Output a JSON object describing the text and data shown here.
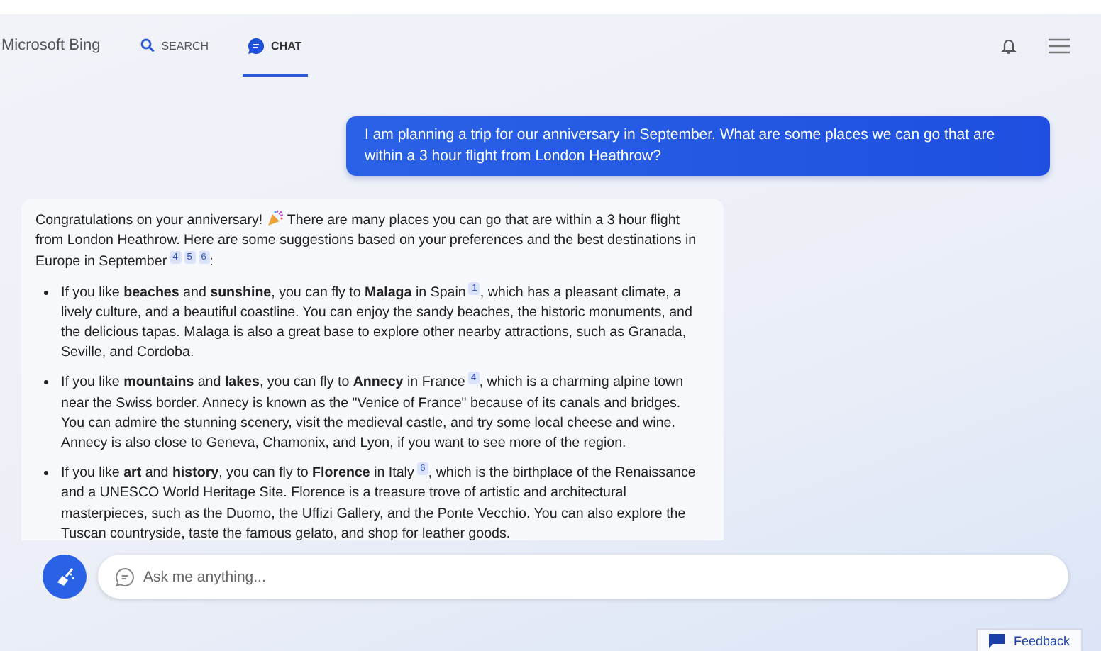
{
  "header": {
    "logo": "Microsoft Bing",
    "tabs": [
      {
        "label": "SEARCH",
        "kind": "search",
        "selected": false
      },
      {
        "label": "CHAT",
        "kind": "chat",
        "selected": true
      }
    ]
  },
  "user_message": "I am planning a trip for our anniversary in September. What are some places we can go that are within a 3 hour flight from London Heathrow?",
  "bot_message": {
    "intro": [
      {
        "kind": "text",
        "text": "Congratulations on your anniversary! "
      },
      {
        "kind": "emoji"
      },
      {
        "kind": "text",
        "text": " There are many places you can go that are within a 3 hour flight from London Heathrow. Here are some suggestions based on your preferences and the best destinations in Europe in September"
      },
      {
        "kind": "cite",
        "text": "4"
      },
      {
        "kind": "cite",
        "text": "5"
      },
      {
        "kind": "cite",
        "text": "6"
      },
      {
        "kind": "text",
        "text": ":"
      }
    ],
    "bullets": [
      [
        {
          "kind": "text",
          "text": "If you like **beaches** and **sunshine**, you can fly to **Malaga** in Spain"
        },
        {
          "kind": "cite",
          "text": "1"
        },
        {
          "kind": "text",
          "text": ", which has a pleasant climate, a lively culture, and a beautiful coastline. You can enjoy the sandy beaches, the historic monuments, and the delicious tapas. Malaga is also a great base to explore other nearby attractions, such as Granada, Seville, and Cordoba."
        }
      ],
      [
        {
          "kind": "text",
          "text": "If you like **mountains** and **lakes**, you can fly to **Annecy** in France"
        },
        {
          "kind": "cite",
          "text": "4"
        },
        {
          "kind": "text",
          "text": ", which is a charming alpine town near the Swiss border. Annecy is known as the \"Venice of France\" because of its canals and bridges. You can admire the stunning scenery, visit the medieval castle, and try some local cheese and wine. Annecy is also close to Geneva, Chamonix, and Lyon, if you want to see more of the region."
        }
      ],
      [
        {
          "kind": "text",
          "text": "If you like **art** and **history**, you can fly to **Florence** in Italy"
        },
        {
          "kind": "cite",
          "text": "6"
        },
        {
          "kind": "text",
          "text": ", which is the birthplace of the Renaissance and a UNESCO World Heritage Site. Florence is a treasure trove of artistic and architectural masterpieces, such as the Duomo, the Uffizi Gallery, and the Ponte Vecchio. You can also explore the Tuscan countryside, taste the famous gelato, and shop for leather goods."
        }
      ]
    ]
  },
  "input": {
    "placeholder": "Ask me anything..."
  },
  "feedback": "Feedback"
}
